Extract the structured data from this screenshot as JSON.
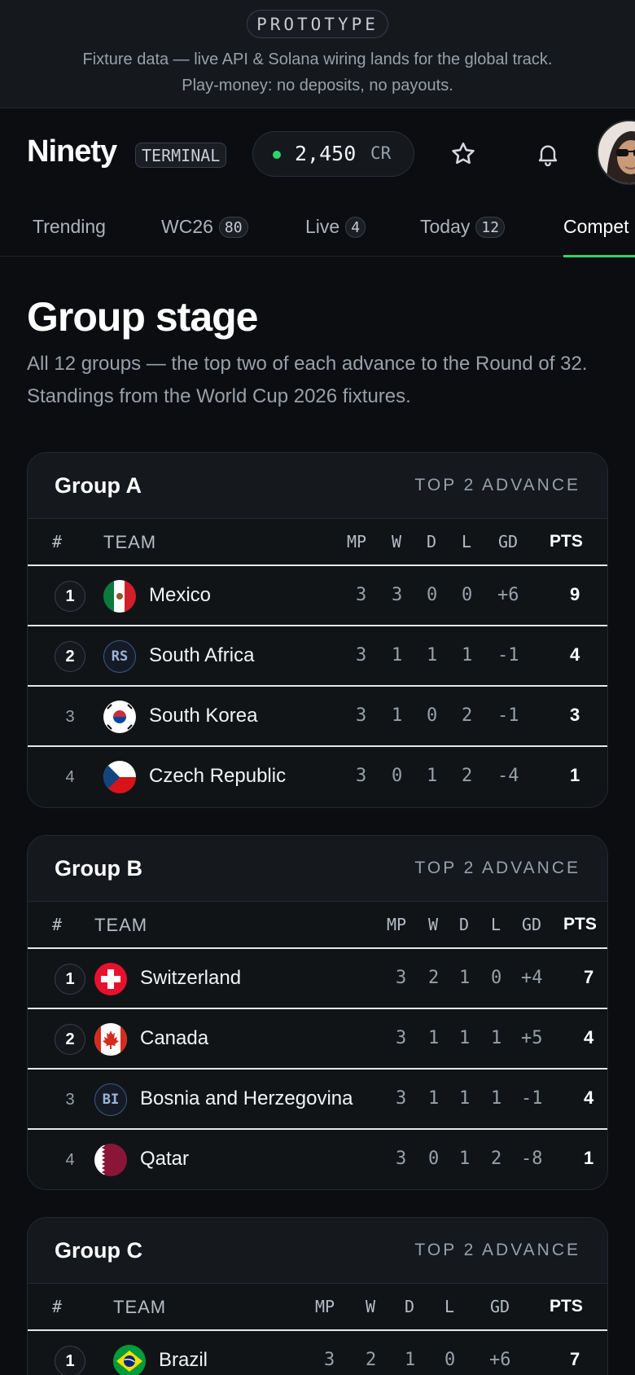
{
  "banner": {
    "pill": "PROTOTYPE",
    "line1": "Fixture data — live API & Solana wiring lands for the global track.",
    "line2": "Play-money: no deposits, no payouts."
  },
  "header": {
    "logo": "Ninety",
    "badge": "TERMINAL",
    "credits_amount": "2,450",
    "credits_unit": "CR",
    "status_color": "#2fd36b"
  },
  "tabs": [
    {
      "label": "Trending",
      "count": ""
    },
    {
      "label": "WC26",
      "count": "80"
    },
    {
      "label": "Live",
      "count": "4"
    },
    {
      "label": "Today",
      "count": "12"
    },
    {
      "label": "Compet",
      "count": ""
    }
  ],
  "page": {
    "title": "Group stage",
    "description": "All 12 groups — the top two of each advance to the Round of 32. Standings from the World Cup 2026 fixtures."
  },
  "columns": {
    "rank": "#",
    "team": "TEAM",
    "mp": "MP",
    "w": "W",
    "d": "D",
    "l": "L",
    "gd": "GD",
    "pts": "PTS"
  },
  "groups": [
    {
      "name": "Group A",
      "note": "TOP 2 ADVANCE",
      "rows": [
        {
          "rank": "1",
          "team": "Mexico",
          "flag": "mexico-flag-icon",
          "mp": "3",
          "w": "3",
          "d": "0",
          "l": "0",
          "gd": "+6",
          "pts": "9"
        },
        {
          "rank": "2",
          "team": "South Africa",
          "flag": "RS",
          "mp": "3",
          "w": "1",
          "d": "1",
          "l": "1",
          "gd": "-1",
          "pts": "4"
        },
        {
          "rank": "3",
          "team": "South Korea",
          "flag": "south-korea-flag-icon",
          "mp": "3",
          "w": "1",
          "d": "0",
          "l": "2",
          "gd": "-1",
          "pts": "3"
        },
        {
          "rank": "4",
          "team": "Czech Republic",
          "flag": "czech-flag-icon",
          "mp": "3",
          "w": "0",
          "d": "1",
          "l": "2",
          "gd": "-4",
          "pts": "1"
        }
      ]
    },
    {
      "name": "Group B",
      "note": "TOP 2 ADVANCE",
      "rows": [
        {
          "rank": "1",
          "team": "Switzerland",
          "flag": "switzerland-flag-icon",
          "mp": "3",
          "w": "2",
          "d": "1",
          "l": "0",
          "gd": "+4",
          "pts": "7"
        },
        {
          "rank": "2",
          "team": "Canada",
          "flag": "canada-flag-icon",
          "mp": "3",
          "w": "1",
          "d": "1",
          "l": "1",
          "gd": "+5",
          "pts": "4"
        },
        {
          "rank": "3",
          "team": "Bosnia and Herzegovina",
          "flag": "BI",
          "mp": "3",
          "w": "1",
          "d": "1",
          "l": "1",
          "gd": "-1",
          "pts": "4"
        },
        {
          "rank": "4",
          "team": "Qatar",
          "flag": "qatar-flag-icon",
          "mp": "3",
          "w": "0",
          "d": "1",
          "l": "2",
          "gd": "-8",
          "pts": "1"
        }
      ]
    },
    {
      "name": "Group C",
      "note": "TOP 2 ADVANCE",
      "rows": [
        {
          "rank": "1",
          "team": "Brazil",
          "flag": "brazil-flag-icon",
          "mp": "3",
          "w": "2",
          "d": "1",
          "l": "0",
          "gd": "+6",
          "pts": "7"
        }
      ]
    }
  ]
}
